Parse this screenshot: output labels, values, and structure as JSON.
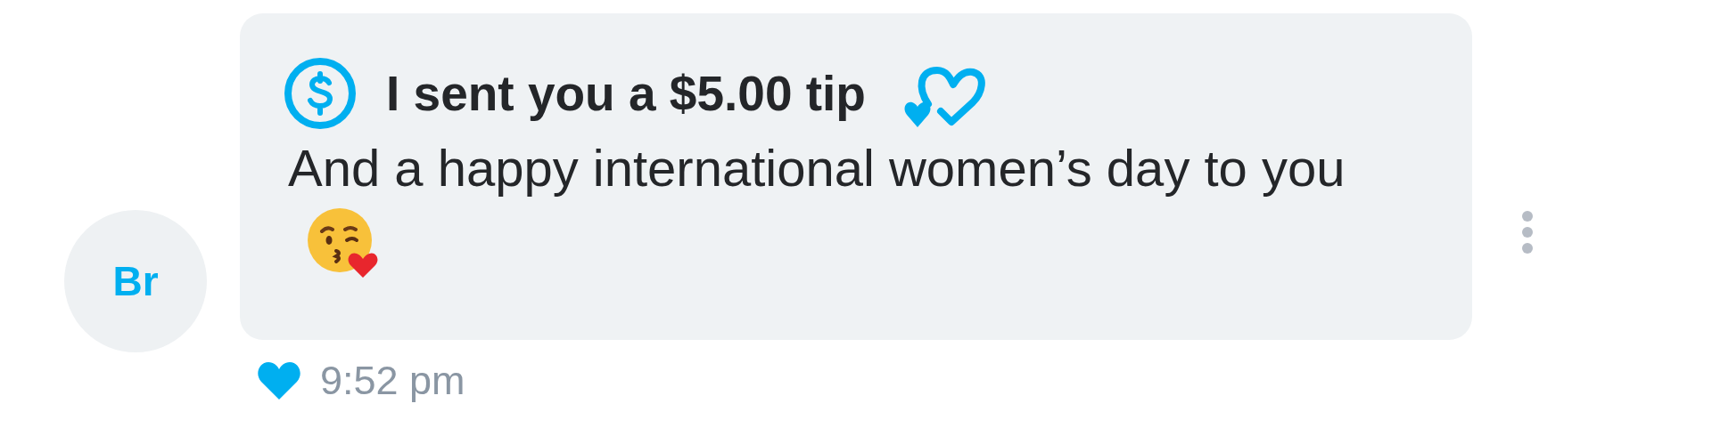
{
  "message": {
    "avatar": {
      "initials": "Br"
    },
    "tip": {
      "title": "I sent you a $5.00 tip"
    },
    "text": "And a happy international women’s day to you",
    "liked": true,
    "time": "9:52 pm"
  }
}
